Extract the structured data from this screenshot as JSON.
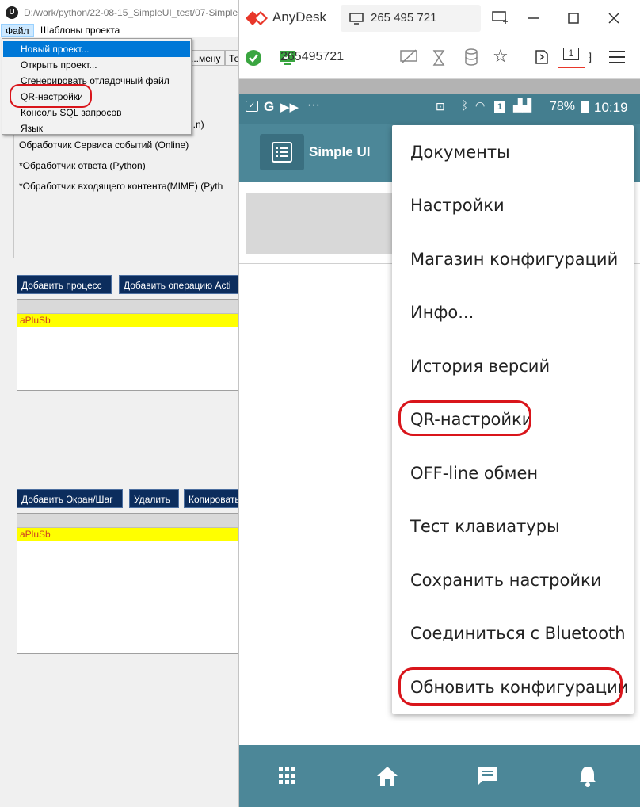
{
  "left_app": {
    "window_title": "D:/work/python/22-08-15_SimpleUI_test/07-Simple...",
    "app_icon_glyph": "U",
    "menubar": [
      "Файл",
      "Шаблоны проекта"
    ],
    "tabs": [
      "...мену",
      "Те"
    ],
    "file_menu": [
      "Новый проект...",
      "Открыть проект...",
      "Сгенерировать отладочный файл",
      "QR-настройки",
      "Консоль SQL запросов",
      "Язык"
    ],
    "panel_lines": [
      "...n)",
      "Обработчик Сервиса событий (Online)",
      "*Обработчик ответа (Python)",
      "*Обработчик входящего контента(MIME) (Pyth"
    ],
    "buttons_top": [
      "Добавить процесс",
      "Добавить операцию Acti"
    ],
    "list_top": [
      "aPluSb"
    ],
    "buttons_bottom": [
      "Добавить Экран/Шаг",
      "Удалить",
      "Копировать"
    ],
    "list_bottom": [
      "aPluSb"
    ]
  },
  "anydesk": {
    "app_name": "AnyDesk",
    "tab_id": "265 495 721",
    "address_id": "265495721",
    "window_controls": [
      "minimize",
      "maximize",
      "close"
    ]
  },
  "phone": {
    "status": {
      "battery": "78%",
      "time": "10:19"
    },
    "app_title": "Simple UI",
    "menu_items": [
      "Документы",
      "Настройки",
      "Магазин конфигураций",
      "Инфо...",
      "История версий",
      "QR-настройки",
      "OFF-line обмен",
      "Тест клавиатуры",
      "Сохранить настройки",
      "Соединиться с Bluetooth",
      "Обновить конфигурации"
    ],
    "bottom_nav_icons": [
      "apps-grid-icon",
      "home-icon",
      "chat-icon",
      "bell-icon"
    ]
  },
  "colors": {
    "accent_red": "#d9151b",
    "anydesk_red": "#e8372a",
    "phone_bar": "#4c8798",
    "nav_button": "#0c2d5d",
    "highlight_row": "#ffff00",
    "menu_selection": "#0078d7"
  }
}
